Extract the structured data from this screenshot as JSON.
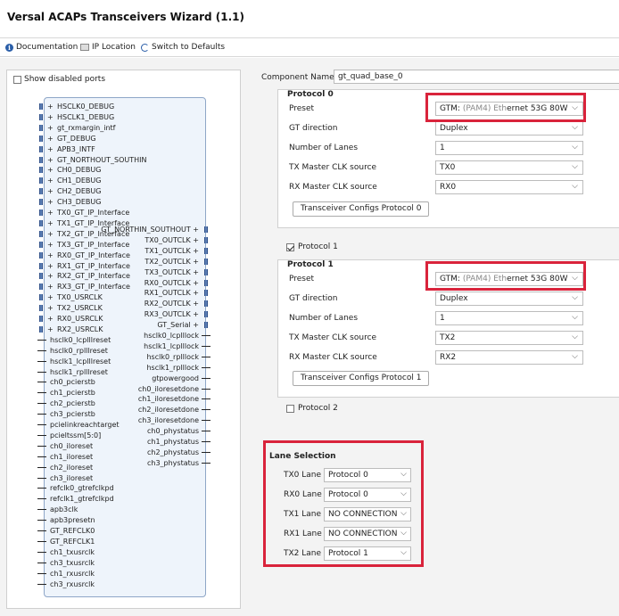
{
  "window": {
    "title": "Versal ACAPs Transceivers Wizard (1.1)"
  },
  "toolbar": {
    "documentation": "Documentation",
    "ip_location": "IP Location",
    "switch_defaults": "Switch to Defaults"
  },
  "left": {
    "show_disabled": "Show disabled ports",
    "left_bus_pins": [
      "HSCLK0_DEBUG",
      "HSCLK1_DEBUG",
      "gt_rxmargin_intf",
      "GT_DEBUG",
      "APB3_INTF",
      "GT_NORTHOUT_SOUTHIN",
      "CH0_DEBUG",
      "CH1_DEBUG",
      "CH2_DEBUG",
      "CH3_DEBUG",
      "TX0_GT_IP_Interface",
      "TX1_GT_IP_Interface",
      "TX2_GT_IP_Interface",
      "TX3_GT_IP_Interface",
      "RX0_GT_IP_Interface",
      "RX1_GT_IP_Interface",
      "RX2_GT_IP_Interface",
      "RX3_GT_IP_Interface",
      "TX0_USRCLK",
      "TX2_USRCLK",
      "RX0_USRCLK",
      "RX2_USRCLK"
    ],
    "left_sig_pins": [
      "hsclk0_lcplllreset",
      "hsclk0_rplllreset",
      "hsclk1_lcplllreset",
      "hsclk1_rplllreset",
      "ch0_pcierstb",
      "ch1_pcierstb",
      "ch2_pcierstb",
      "ch3_pcierstb",
      "pcielinkreachtarget",
      "pcieltssm[5:0]",
      "ch0_iloreset",
      "ch1_iloreset",
      "ch2_iloreset",
      "ch3_iloreset",
      "refclk0_gtrefclkpd",
      "refclk1_gtrefclkpd",
      "apb3clk",
      "apb3presetn",
      "GT_REFCLK0",
      "GT_REFCLK1",
      "ch1_txusrclk",
      "ch3_txusrclk",
      "ch1_rxusrclk",
      "ch3_rxusrclk"
    ],
    "right_bus_pins": [
      "GT_NORTHIN_SOUTHOUT",
      "TX0_OUTCLK",
      "TX1_OUTCLK",
      "TX2_OUTCLK",
      "TX3_OUTCLK",
      "RX0_OUTCLK",
      "RX1_OUTCLK",
      "RX2_OUTCLK",
      "RX3_OUTCLK",
      "GT_Serial"
    ],
    "right_sig_pins": [
      "hsclk0_lcplllock",
      "hsclk1_lcplllock",
      "hsclk0_rplllock",
      "hsclk1_rplllock",
      "gtpowergood",
      "ch0_iloresetdone",
      "ch1_iloresetdone",
      "ch2_iloresetdone",
      "ch3_iloresetdone",
      "ch0_phystatus",
      "ch1_phystatus",
      "ch2_phystatus",
      "ch3_phystatus"
    ]
  },
  "right": {
    "component_label": "Component Name",
    "component_value": "gt_quad_base_0",
    "protocol0": {
      "title": "Protocol 0",
      "preset_label": "Preset",
      "preset_value_prefix": "GTM: ",
      "preset_value_grey": "(PAM4) Eth",
      "preset_value_rest": "ernet 53G 80W",
      "direction_label": "GT direction",
      "direction_value": "Duplex",
      "lanes_label": "Number of Lanes",
      "lanes_value": "1",
      "tx_label": "TX Master CLK source",
      "tx_value": "TX0",
      "rx_label": "RX Master CLK source",
      "rx_value": "RX0",
      "config_button": "Transceiver Configs Protocol 0"
    },
    "protocol1_checkbox": "Protocol 1",
    "protocol1": {
      "title": "Protocol 1",
      "preset_label": "Preset",
      "preset_value_prefix": "GTM: ",
      "preset_value_grey": "(PAM4) Eth",
      "preset_value_rest": "ernet 53G 80W",
      "direction_label": "GT direction",
      "direction_value": "Duplex",
      "lanes_label": "Number of Lanes",
      "lanes_value": "1",
      "tx_label": "TX Master CLK source",
      "tx_value": "TX2",
      "rx_label": "RX Master CLK source",
      "rx_value": "RX2",
      "config_button": "Transceiver Configs Protocol 1"
    },
    "protocol2_checkbox": "Protocol 2",
    "lane_selection": {
      "title": "Lane Selection",
      "lanes": [
        {
          "label": "TX0 Lane",
          "value": "Protocol 0"
        },
        {
          "label": "RX0 Lane",
          "value": "Protocol 0"
        },
        {
          "label": "TX1 Lane",
          "value": "NO CONNECTION"
        },
        {
          "label": "RX1 Lane",
          "value": "NO CONNECTION"
        },
        {
          "label": "TX2 Lane",
          "value": "Protocol 1"
        }
      ]
    }
  },
  "colors": {
    "highlight": "#d9233b",
    "block_fill": "#eef4fb",
    "bus": "#5c7fb5"
  }
}
